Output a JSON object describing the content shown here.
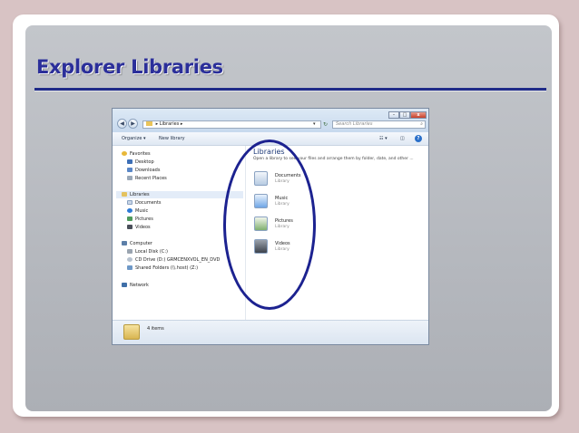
{
  "slide": {
    "title": "Explorer Libraries"
  },
  "window": {
    "address": {
      "path": "Libraries",
      "sep_icon": "▸",
      "after_icon": "▸"
    },
    "search_placeholder": "Search Libraries",
    "toolbar": {
      "organize": "Organize ▾",
      "new_library": "New library",
      "views": "☷ ▾",
      "pane": "◫",
      "help": "?"
    },
    "nav": {
      "favorites": "Favorites",
      "desktop": "Desktop",
      "downloads": "Downloads",
      "recent_places": "Recent Places",
      "libraries": "Libraries",
      "documents": "Documents",
      "music": "Music",
      "pictures": "Pictures",
      "videos": "Videos",
      "computer": "Computer",
      "local_disk": "Local Disk (C:)",
      "cd_drive": "CD Drive (D:) GRMCENXVOL_EN_DVD",
      "shared_folders": "Shared Folders (\\\\.host) (Z:)",
      "network": "Network"
    },
    "content": {
      "heading": "Libraries",
      "subtitle": "Open a library to see your files and arrange them by folder, date, and other ...",
      "items": [
        {
          "name": "Documents",
          "kind": "Library"
        },
        {
          "name": "Music",
          "kind": "Library"
        },
        {
          "name": "Pictures",
          "kind": "Library"
        },
        {
          "name": "Videos",
          "kind": "Library"
        }
      ]
    },
    "status": {
      "count": "4 items"
    }
  },
  "colors": {
    "title": "#2b2f9a",
    "ellipse": "#1c2290",
    "slide_bg": "#b9bcc2"
  }
}
